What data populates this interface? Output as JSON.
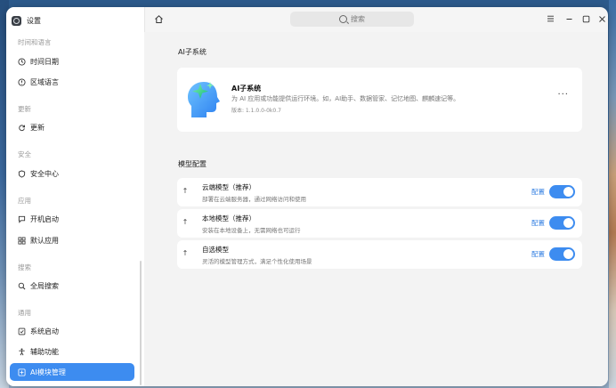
{
  "app": {
    "title": "设置"
  },
  "sidebar": {
    "groups": [
      {
        "title": "时间和语言",
        "items": [
          {
            "label": "时间日期",
            "icon": "clock-icon"
          },
          {
            "label": "区域语言",
            "icon": "globe-icon"
          }
        ]
      },
      {
        "title": "更新",
        "items": [
          {
            "label": "更新",
            "icon": "refresh-icon"
          }
        ]
      },
      {
        "title": "安全",
        "items": [
          {
            "label": "安全中心",
            "icon": "shield-icon"
          }
        ]
      },
      {
        "title": "应用",
        "items": [
          {
            "label": "开机启动",
            "icon": "chat-icon"
          },
          {
            "label": "默认应用",
            "icon": "grid-icon"
          }
        ]
      },
      {
        "title": "搜索",
        "items": [
          {
            "label": "全局搜索",
            "icon": "search-icon"
          }
        ]
      },
      {
        "title": "通用",
        "items": [
          {
            "label": "系统启动",
            "icon": "boot-icon"
          },
          {
            "label": "辅助功能",
            "icon": "accessibility-icon"
          },
          {
            "label": "AI模块管理",
            "icon": "ai-module-icon",
            "active": true
          }
        ]
      }
    ]
  },
  "search": {
    "placeholder": "搜索"
  },
  "main": {
    "ai_section_title": "AI子系统",
    "ai_card": {
      "name": "AI子系统",
      "description": "为 AI 应用或功能提供运行环境。如，AI助手、数据管家、记忆地图、麒麟速记等。",
      "version": "版本: 1.1.0.0-0k0.7",
      "more_label": "···"
    },
    "model_section_title": "模型配置",
    "models": [
      {
        "title": "云端模型（推荐）",
        "desc": "部署在云端服务器，通过网络访问和使用",
        "link": "配置",
        "enabled": true
      },
      {
        "title": "本地模型（推荐）",
        "desc": "安装在本地设备上，无需网络也可运行",
        "link": "配置",
        "enabled": true
      },
      {
        "title": "自选模型",
        "desc": "灵活的模型管理方式，满足个性化使用场景",
        "link": "配置",
        "enabled": true
      }
    ]
  },
  "colors": {
    "accent": "#3d8cf0",
    "link": "#2f7de1"
  }
}
